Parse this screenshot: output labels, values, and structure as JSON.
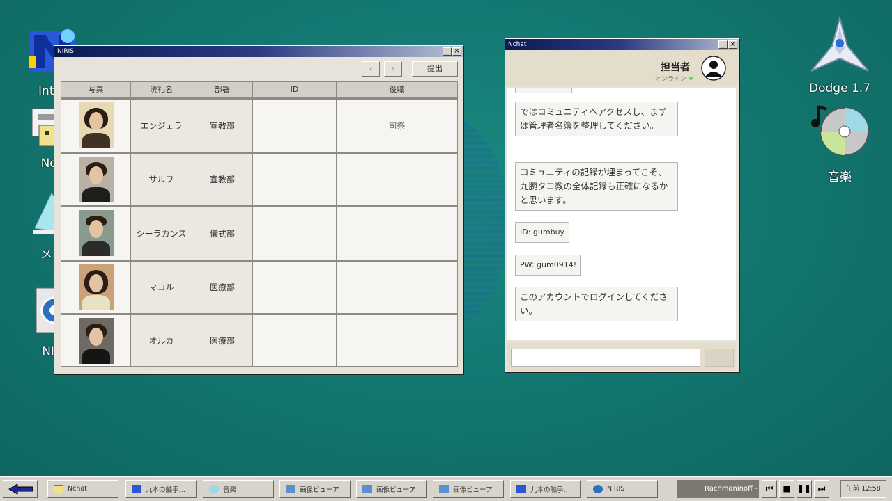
{
  "desktop": {
    "icons_left": [
      {
        "label": "Inter",
        "icon": "internet-icon"
      },
      {
        "label": "Nch",
        "icon": "nchat-icon"
      },
      {
        "label": "メモ",
        "icon": "memo-icon"
      },
      {
        "label": "NIR",
        "icon": "niris-icon"
      }
    ],
    "icons_right": [
      {
        "label": "Dodge 1.7",
        "icon": "spaceship-icon"
      },
      {
        "label": "音楽",
        "icon": "music-cd-icon"
      }
    ]
  },
  "niris": {
    "title": "NIRIS",
    "prev": "‹",
    "next": "›",
    "submit": "提出",
    "columns": [
      "写真",
      "洗礼名",
      "部署",
      "ID",
      "役職"
    ],
    "rows": [
      {
        "name": "エンジェラ",
        "dept": "宣教部",
        "id": "",
        "role": "司祭"
      },
      {
        "name": "サルフ",
        "dept": "宣教部",
        "id": "",
        "role": ""
      },
      {
        "name": "シーラカンス",
        "dept": "儀式部",
        "id": "",
        "role": ""
      },
      {
        "name": "マコル",
        "dept": "医療部",
        "id": "",
        "role": ""
      },
      {
        "name": "オルカ",
        "dept": "医療部",
        "id": "",
        "role": ""
      }
    ]
  },
  "nchat": {
    "title": "Nchat",
    "contact_name": "担当者",
    "contact_status": "オンライン",
    "messages": [
      "ではコミュニティへアクセスし、まずは管理者名簿を整理してください。",
      "コミュニティの記録が埋まってこそ、九腕タコ教の全体記録も正確になるかと思います。",
      "ID: gumbuy",
      "PW: gum0914!",
      "このアカウントでログインしてください。"
    ],
    "colors": {
      "online": "#5cd65c"
    }
  },
  "taskbar": {
    "items": [
      "Nchat",
      "九本の触手…",
      "音楽",
      "画像ビューア",
      "画像ビューア",
      "画像ビューア",
      "九本の触手…",
      "NIRIS"
    ],
    "now_playing": "Rachmaninoff -",
    "clock": "午前 12:58"
  }
}
